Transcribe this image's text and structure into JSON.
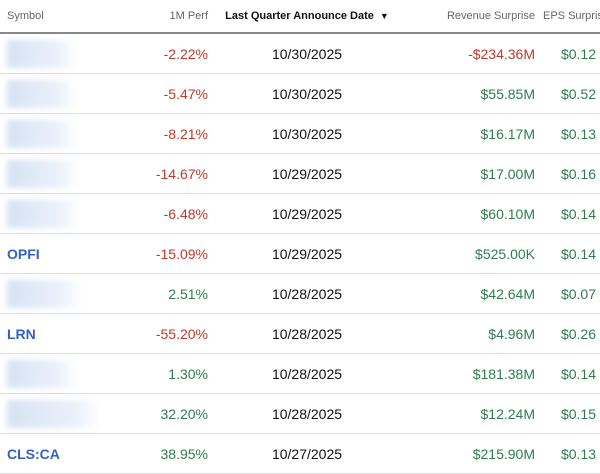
{
  "table": {
    "columns": [
      "Symbol",
      "1M Perf",
      "Last Quarter Announce Date",
      "Revenue Surprise",
      "EPS Surprise"
    ],
    "sort_indicator": "▼",
    "rows": [
      {
        "symbol": "",
        "perf": "-2.22%",
        "perf_dir": "neg",
        "date": "10/30/2025",
        "rev": "-$234.36M",
        "rev_dir": "neg",
        "eps": "$0.12",
        "eps_dir": "pos"
      },
      {
        "symbol": "",
        "perf": "-5.47%",
        "perf_dir": "neg",
        "date": "10/30/2025",
        "rev": "$55.85M",
        "rev_dir": "pos",
        "eps": "$0.52",
        "eps_dir": "pos"
      },
      {
        "symbol": "",
        "perf": "-8.21%",
        "perf_dir": "neg",
        "date": "10/30/2025",
        "rev": "$16.17M",
        "rev_dir": "pos",
        "eps": "$0.13",
        "eps_dir": "pos"
      },
      {
        "symbol": "",
        "perf": "-14.67%",
        "perf_dir": "neg",
        "date": "10/29/2025",
        "rev": "$17.00M",
        "rev_dir": "pos",
        "eps": "$0.16",
        "eps_dir": "pos"
      },
      {
        "symbol": "",
        "perf": "-6.48%",
        "perf_dir": "neg",
        "date": "10/29/2025",
        "rev": "$60.10M",
        "rev_dir": "pos",
        "eps": "$0.14",
        "eps_dir": "pos"
      },
      {
        "symbol": "OPFI",
        "perf": "-15.09%",
        "perf_dir": "neg",
        "date": "10/29/2025",
        "rev": "$525.00K",
        "rev_dir": "pos",
        "eps": "$0.14",
        "eps_dir": "pos"
      },
      {
        "symbol": "",
        "perf": "2.51%",
        "perf_dir": "pos",
        "date": "10/28/2025",
        "rev": "$42.64M",
        "rev_dir": "pos",
        "eps": "$0.07",
        "eps_dir": "pos"
      },
      {
        "symbol": "LRN",
        "perf": "-55.20%",
        "perf_dir": "neg",
        "date": "10/28/2025",
        "rev": "$4.96M",
        "rev_dir": "pos",
        "eps": "$0.26",
        "eps_dir": "pos"
      },
      {
        "symbol": "",
        "perf": "1.30%",
        "perf_dir": "pos",
        "date": "10/28/2025",
        "rev": "$181.38M",
        "rev_dir": "pos",
        "eps": "$0.14",
        "eps_dir": "pos"
      },
      {
        "symbol": "",
        "perf": "32.20%",
        "perf_dir": "pos",
        "date": "10/28/2025",
        "rev": "$12.24M",
        "rev_dir": "pos",
        "eps": "$0.15",
        "eps_dir": "pos"
      },
      {
        "symbol": "CLS:CA",
        "perf": "38.95%",
        "perf_dir": "pos",
        "date": "10/27/2025",
        "rev": "$215.90M",
        "rev_dir": "pos",
        "eps": "$0.13",
        "eps_dir": "pos"
      }
    ]
  },
  "colors": {
    "negative": "#c0392b",
    "positive": "#2e7d4f",
    "link": "#3461c1"
  }
}
